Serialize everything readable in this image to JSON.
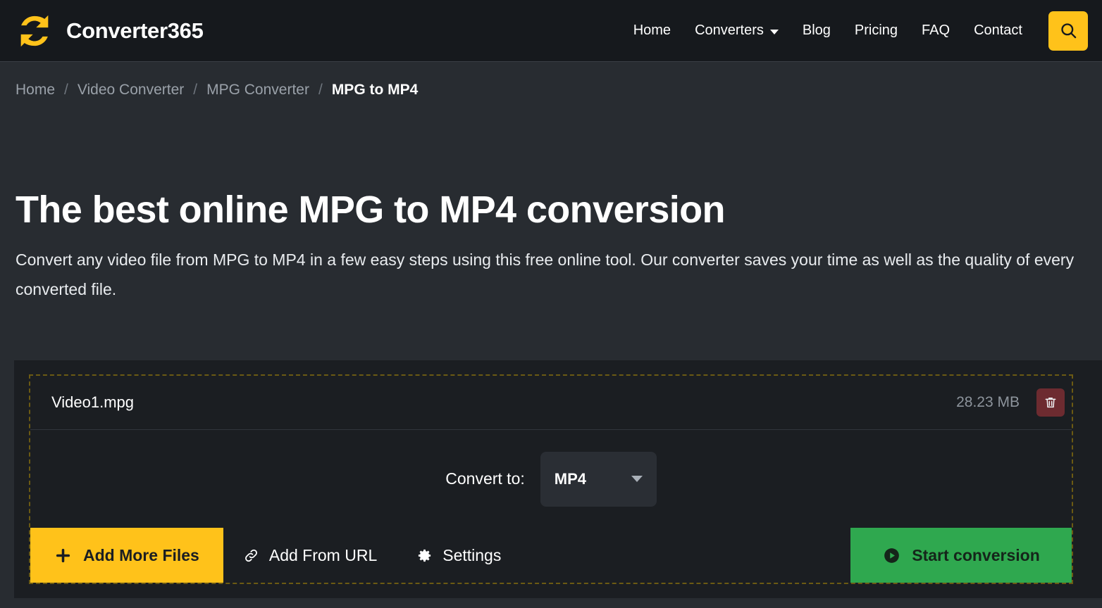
{
  "header": {
    "brand_name": "Converter365",
    "logo_icon": "refresh-sync-icon",
    "nav": [
      {
        "label": "Home",
        "has_dropdown": false
      },
      {
        "label": "Converters",
        "has_dropdown": true
      },
      {
        "label": "Blog",
        "has_dropdown": false
      },
      {
        "label": "Pricing",
        "has_dropdown": false
      },
      {
        "label": "FAQ",
        "has_dropdown": false
      },
      {
        "label": "Contact",
        "has_dropdown": false
      }
    ],
    "search_icon": "search-icon"
  },
  "breadcrumb": [
    {
      "label": "Home",
      "active": false
    },
    {
      "label": "Video Converter",
      "active": false
    },
    {
      "label": "MPG Converter",
      "active": false
    },
    {
      "label": "MPG to MP4",
      "active": true
    }
  ],
  "breadcrumb_separator": "/",
  "hero": {
    "title": "The best online MPG to MP4 conversion",
    "description": "Convert any video file from MPG to MP4 in a few easy steps using this free online tool. Our converter saves your time as well as the quality of every converted file."
  },
  "upload_panel": {
    "file": {
      "name": "Video1.mpg",
      "size": "28.23 MB",
      "delete_icon": "trash-icon"
    },
    "convert_to_label": "Convert to:",
    "format_value": "MP4",
    "format_caret_icon": "chevron-down-icon",
    "actions": {
      "add_files_label": "Add More Files",
      "add_files_icon": "plus-icon",
      "add_url_label": "Add From URL",
      "add_url_icon": "link-icon",
      "settings_label": "Settings",
      "settings_icon": "gear-icon",
      "start_label": "Start conversion",
      "start_icon": "play-circle-icon"
    }
  },
  "colors": {
    "accent_yellow": "#ffc21a",
    "start_green": "#2fa84f",
    "delete_red": "#6d2b30",
    "page_bg": "#282c31",
    "header_bg": "#16191d",
    "panel_bg": "#1b1e22",
    "dashed_border": "#6b5a13"
  }
}
